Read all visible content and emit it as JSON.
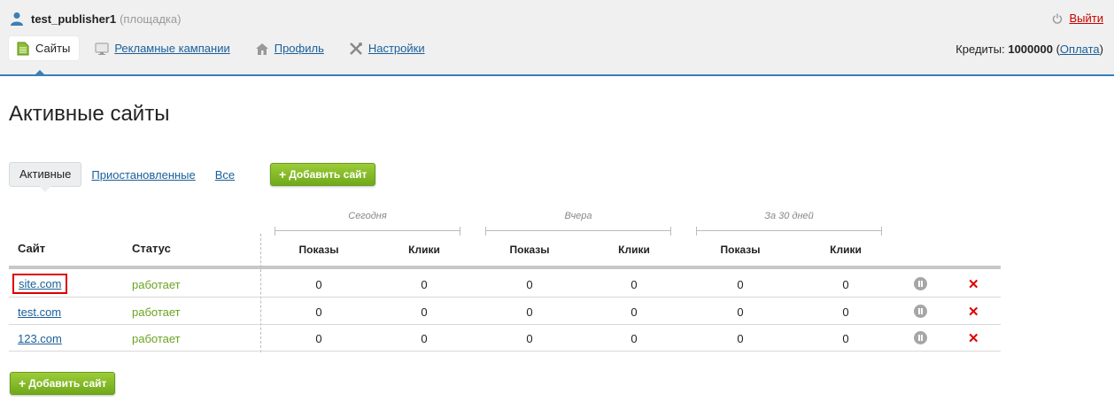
{
  "user": {
    "name": "test_publisher1",
    "role": "(площадка)"
  },
  "logout_label": "Выйти",
  "nav": [
    {
      "label": "Сайты",
      "icon": "document-icon"
    },
    {
      "label": "Рекламные кампании",
      "icon": "monitor-icon"
    },
    {
      "label": "Профиль",
      "icon": "home-icon"
    },
    {
      "label": "Настройки",
      "icon": "wrench-icon"
    }
  ],
  "credits": {
    "label": "Кредиты:",
    "value": "1000000",
    "pay": "Оплата"
  },
  "page_title": "Активные сайты",
  "tabs": {
    "active": "Активные",
    "paused": "Приостановленные",
    "all": "Все"
  },
  "add_site_label": "Добавить сайт",
  "table": {
    "col_site": "Сайт",
    "col_status": "Статус",
    "groups": [
      "Сегодня",
      "Вчера",
      "За 30 дней"
    ],
    "sub_impressions": "Показы",
    "sub_clicks": "Клики",
    "rows": [
      {
        "site": "site.com",
        "status": "работает",
        "v": [
          "0",
          "0",
          "0",
          "0",
          "0",
          "0"
        ]
      },
      {
        "site": "test.com",
        "status": "работает",
        "v": [
          "0",
          "0",
          "0",
          "0",
          "0",
          "0"
        ]
      },
      {
        "site": "123.com",
        "status": "работает",
        "v": [
          "0",
          "0",
          "0",
          "0",
          "0",
          "0"
        ]
      }
    ]
  },
  "colors": {
    "accent": "#3a7fb5",
    "status_ok": "#6aa321",
    "button_green": "#8bc034",
    "delete": "#dd0000",
    "highlight": "#dd0000"
  }
}
